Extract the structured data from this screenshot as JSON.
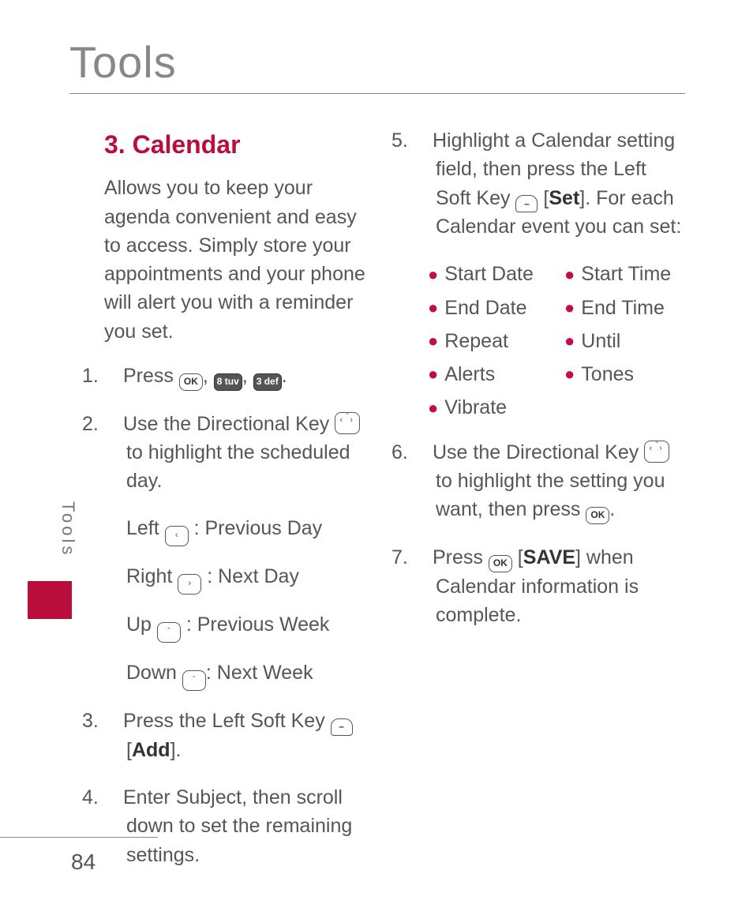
{
  "header": {
    "title": "Tools"
  },
  "sidetab": {
    "label": "Tools"
  },
  "pagenum": "84",
  "section": {
    "heading": "3. Calendar"
  },
  "intro": "Allows you to keep your agenda convenient and easy to access. Simply store your appointments and your phone will alert you with a reminder you set.",
  "steps": {
    "s1": {
      "num": "1.",
      "a": "Press ",
      "b": ", ",
      "c": ", ",
      "d": "."
    },
    "s2": {
      "num": "2.",
      "a": "Use the Directional Key ",
      "b": " to highlight  the scheduled day."
    },
    "s2_left": {
      "a": "Left ",
      "b": " : Previous Day"
    },
    "s2_right": {
      "a": "Right ",
      "b": " : Next Day"
    },
    "s2_up": {
      "a": "Up ",
      "b": " : Previous Week"
    },
    "s2_down": {
      "a": "Down ",
      "b": ": Next Week"
    },
    "s3": {
      "num": "3.",
      "a": "Press the Left Soft Key  ",
      "b": " [",
      "bold": "Add",
      "c": "]."
    },
    "s4": {
      "num": "4.",
      "text": "Enter Subject, then scroll down to set the remaining settings."
    },
    "s5": {
      "num": "5.",
      "a": "Highlight a Calendar setting field, then press the Left Soft Key  ",
      "b": " [",
      "bold": "Set",
      "c": "]. For each Calendar event you can set:"
    },
    "s6": {
      "num": "6.",
      "a": "Use the Directional Key ",
      "b": " to highlight the setting you want, then press ",
      "c": "."
    },
    "s7": {
      "num": "7.",
      "a": "Press ",
      "b": " [",
      "bold": "SAVE",
      "c": "] when Calendar information is complete."
    }
  },
  "settings": [
    "Start Date",
    "Start Time",
    "End Date",
    "End Time",
    "Repeat",
    "Until",
    "Alerts",
    "Tones",
    "Vibrate"
  ],
  "keys": {
    "ok": "OK",
    "eight": "8 tuv",
    "three": "3 def",
    "dash": "–"
  }
}
